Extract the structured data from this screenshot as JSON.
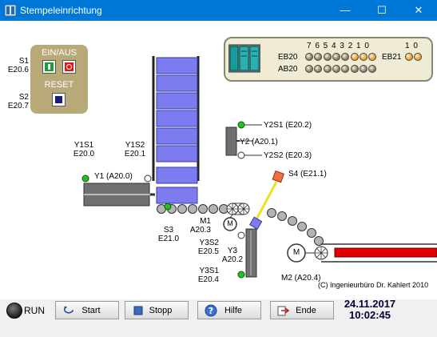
{
  "window": {
    "title": "Stempeleinrichtung",
    "minimize": "—",
    "maximize": "☐",
    "close": "✕"
  },
  "panel": {
    "onoff_label": "EIN/AUS",
    "reset_label": "RESET",
    "s1_name": "S1",
    "s1_addr": "E20.6",
    "s2_name": "S2",
    "s2_addr": "E20.7"
  },
  "led_panel": {
    "bit_header": "7 6 5 4 3 2 1 0",
    "bit_header2": "1 0",
    "row1_label": "EB20",
    "row1b_label": "EB21",
    "row2_label": "AB20",
    "eb20_bits": [
      0,
      0,
      0,
      0,
      0,
      1,
      1,
      1
    ],
    "eb21_bits": [
      1,
      1
    ],
    "ab20_bits": [
      0,
      0,
      0,
      0,
      0,
      0,
      0,
      0
    ],
    "colors": {
      "on": "#f0a020",
      "off": "#8a8060"
    }
  },
  "labels": {
    "y1s1_name": "Y1S1",
    "y1s1_addr": "E20.0",
    "y1s2_name": "Y1S2",
    "y1s2_addr": "E20.1",
    "y1": "Y1 (A20.0)",
    "y2s1": "Y2S1 (E20.2)",
    "y2": "Y2 (A20.1)",
    "y2s2": "Y2S2 (E20.3)",
    "s4": "S4 (E21.1)",
    "s3_name": "S3",
    "s3_addr": "E21.0",
    "m1_name": "M1",
    "m1_addr": "A20.3",
    "y3s2_name": "Y3S2",
    "y3s2_addr": "E20.5",
    "y3_name": "Y3",
    "y3_addr": "A20.2",
    "y3s1_name": "Y3S1",
    "y3s1_addr": "E20.4",
    "m2": "M2 (A20.4)",
    "motor_letter": "M",
    "copyright": "(C) Ingenieurbüro Dr. Kahlert 2010"
  },
  "status": {
    "run_label": "RUN",
    "start_label": "Start",
    "stop_label": "Stopp",
    "help_label": "Hilfe",
    "end_label": "Ende",
    "date": "24.11.2017",
    "time": "10:02:45"
  }
}
